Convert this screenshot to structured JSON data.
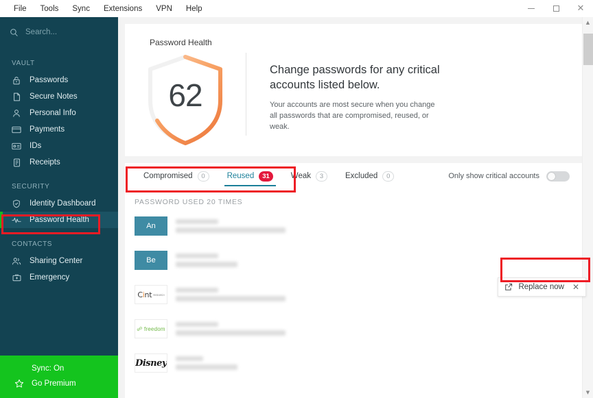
{
  "window": {
    "menu": [
      "File",
      "Tools",
      "Sync",
      "Extensions",
      "VPN",
      "Help"
    ],
    "controls": {
      "minimize": "minimize-button",
      "maximize": "maximize-button",
      "close": "close-button"
    }
  },
  "sidebar": {
    "search": {
      "placeholder": "Search...",
      "value": ""
    },
    "sections": [
      {
        "label": "VAULT",
        "items": [
          {
            "label": "Passwords",
            "icon": "lock-icon"
          },
          {
            "label": "Secure Notes",
            "icon": "note-icon"
          },
          {
            "label": "Personal Info",
            "icon": "person-icon"
          },
          {
            "label": "Payments",
            "icon": "credit-card-icon"
          },
          {
            "label": "IDs",
            "icon": "id-card-icon"
          },
          {
            "label": "Receipts",
            "icon": "receipt-icon"
          }
        ]
      },
      {
        "label": "SECURITY",
        "items": [
          {
            "label": "Identity Dashboard",
            "icon": "shield-icon"
          },
          {
            "label": "Password Health",
            "icon": "pulse-icon",
            "active": true
          }
        ]
      },
      {
        "label": "CONTACTS",
        "items": [
          {
            "label": "Sharing Center",
            "icon": "share-people-icon"
          },
          {
            "label": "Emergency",
            "icon": "briefcase-icon"
          }
        ]
      }
    ],
    "promo": {
      "sync_label": "Sync: On",
      "premium_label": "Go Premium",
      "premium_icon": "star-icon",
      "background": "#14c41e"
    },
    "background": "#134352",
    "active_accent": "#17b822"
  },
  "health": {
    "card_title": "Password Health",
    "score": "62",
    "headline": "Change passwords for any critical accounts listed below.",
    "subtext": "Your accounts are most secure when you change all passwords that are compromised, reused, or weak.",
    "arc_color_start": "#fbb678",
    "arc_color_end": "#ef7f43",
    "arc_track_color": "#f1f1f1"
  },
  "tabs": {
    "items": [
      {
        "label": "Compromised",
        "count": "0",
        "active": false
      },
      {
        "label": "Reused",
        "count": "31",
        "active": true
      },
      {
        "label": "Weak",
        "count": "3",
        "active": false
      },
      {
        "label": "Excluded",
        "count": "0",
        "active": false
      }
    ],
    "active_color": "#1b7f99",
    "badge_color": "#e3183c",
    "filter": {
      "label": "Only show critical accounts",
      "enabled": false
    }
  },
  "list": {
    "group_header": "PASSWORD USED 20 TIMES",
    "rows": [
      {
        "logo_type": "tile",
        "logo_text": "An"
      },
      {
        "logo_type": "tile",
        "logo_text": "Be"
      },
      {
        "logo_type": "cint",
        "logo_text": "Cint"
      },
      {
        "logo_type": "freedom",
        "logo_text": "freedom"
      },
      {
        "logo_type": "disney",
        "logo_text": "Disney"
      }
    ]
  },
  "replace_popover": {
    "label": "Replace now",
    "icon": "external-link-icon",
    "close_icon": "close-icon"
  },
  "scrollbar": {
    "up_arrow": "chevron-up-icon",
    "down_arrow": "chevron-down-icon"
  },
  "annotations": {
    "color": "#ee1c25",
    "targets": [
      "sidebar-item-password-health",
      "tabs-bar",
      "replace-now-popover"
    ]
  }
}
